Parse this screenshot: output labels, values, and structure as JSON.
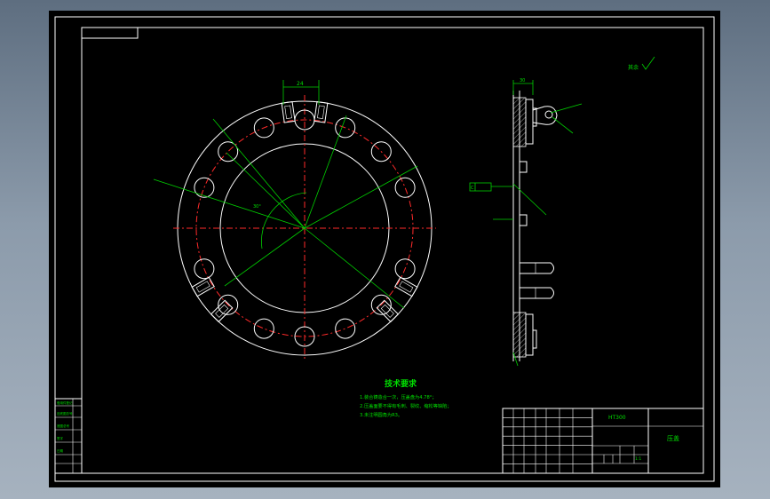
{
  "tech_requirements": {
    "title": "技术要求",
    "items": [
      "1.装合铸造合一次，压盖盘为4.78°；",
      "2.压盖面要不得有毛刺、裂纹、缩松等缺陷；",
      "3.未注明圆角为R3。"
    ]
  },
  "title_block": {
    "part_name": "压盖",
    "code": "HT300",
    "scale": "1:1"
  },
  "roughness_label": "其余",
  "datum_label": "C",
  "dimensions": {
    "slot_width": "24",
    "flange_thickness": "30",
    "angle": "30°"
  },
  "left_stamp": [
    "借用件登记",
    "旧底图总号",
    "底图总号",
    "签字",
    "日期"
  ]
}
